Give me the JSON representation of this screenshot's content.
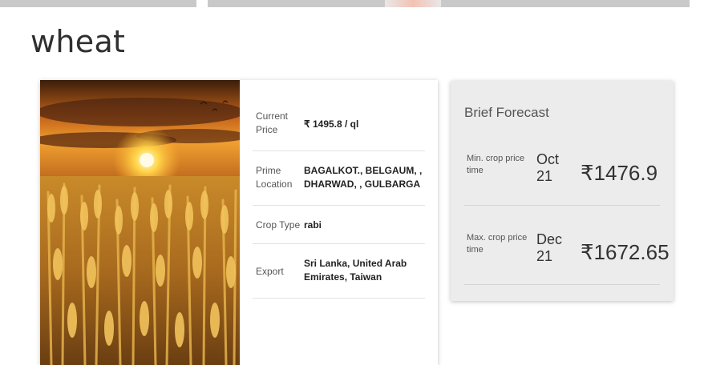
{
  "crop": {
    "name": "wheat"
  },
  "details": [
    {
      "label": "Current Price",
      "value": "₹ 1495.8 / ql"
    },
    {
      "label": "Prime Location",
      "value": "BAGALKOT., BELGAUM, , DHARWAD, , GULBARGA"
    },
    {
      "label": "Crop Type",
      "value": "rabi"
    },
    {
      "label": "Export",
      "value": "Sri Lanka, United Arab Emirates, Taiwan"
    }
  ],
  "forecast": {
    "title": "Brief Forecast",
    "min": {
      "label": "Min. crop price time",
      "month": "Oct",
      "year": "21",
      "price": "₹1476.9"
    },
    "max": {
      "label": "Max. crop price time",
      "month": "Dec",
      "year": "21",
      "price": "₹1672.65"
    }
  }
}
